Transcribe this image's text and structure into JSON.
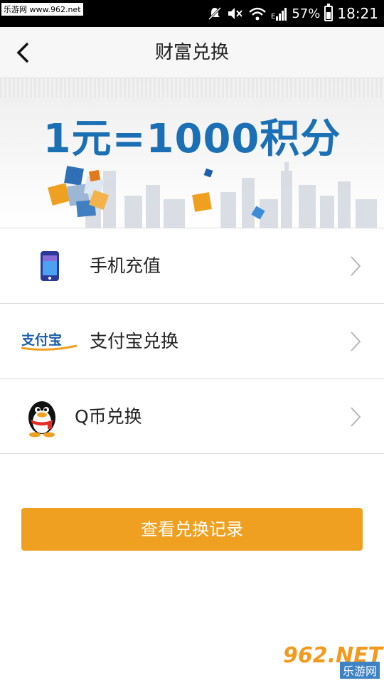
{
  "status_bar": {
    "watermark": "乐游网 www.962.net",
    "network_label": "E",
    "battery": "57%",
    "battery_level": 0.57,
    "time": "18:21",
    "icons": [
      "mute-icon",
      "volume-off-icon",
      "wifi-icon",
      "signal-icon",
      "battery-icon"
    ]
  },
  "header": {
    "title": "财富兑换",
    "back_icon": "chevron-left-icon"
  },
  "banner": {
    "text": "1元=1000积分"
  },
  "menu": {
    "items": [
      {
        "label": "手机充值",
        "icon": "phone-icon"
      },
      {
        "label": "支付宝兑换",
        "icon": "alipay-logo"
      },
      {
        "label": "Q币兑换",
        "icon": "qq-penguin-icon"
      }
    ]
  },
  "actions": {
    "record_button": "查看兑换记录"
  },
  "watermark": {
    "number": "962.NET",
    "sub": "乐游网"
  },
  "colors": {
    "accent": "#f0a020",
    "banner_text": "#1a6fb5",
    "status_bar": "#000000",
    "title_bar": "#f7f7f7"
  }
}
